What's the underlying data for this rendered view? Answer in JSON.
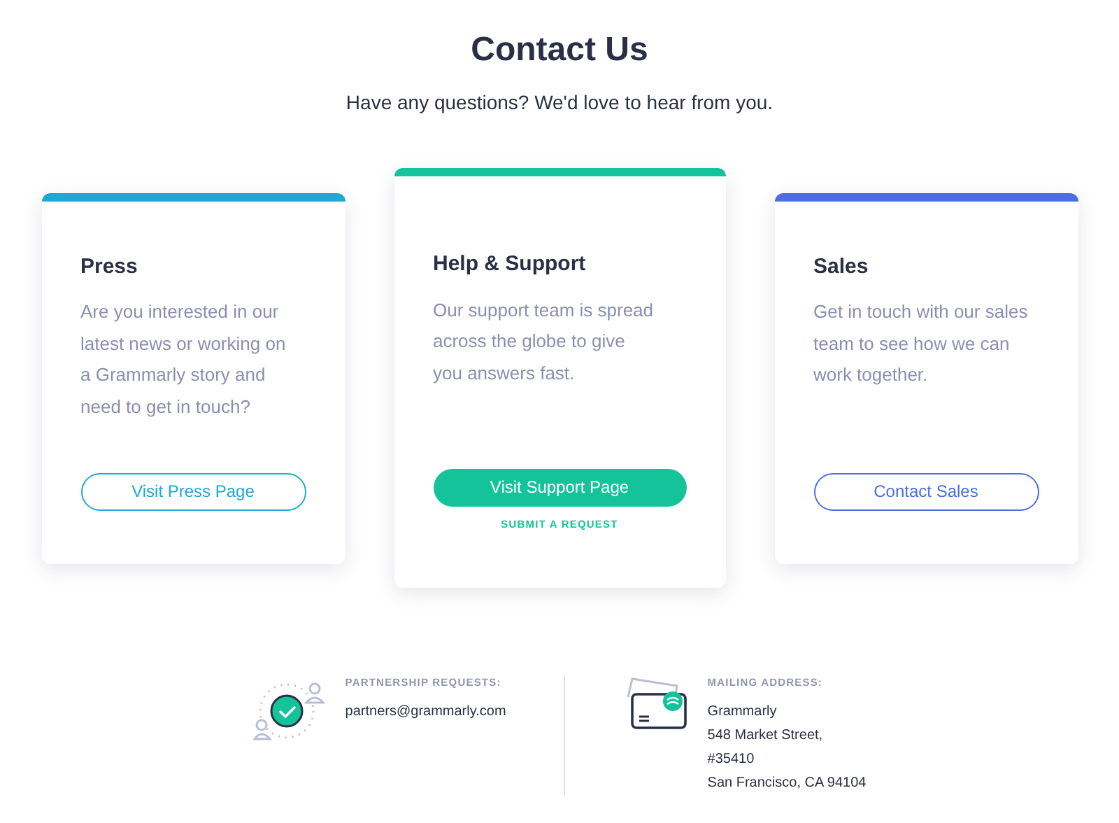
{
  "header": {
    "title": "Contact Us",
    "subtitle": "Have any questions? We'd love to hear from you."
  },
  "cards": [
    {
      "title": "Press",
      "description": "Are you interested in our latest news or working on a Grammarly story and need to get in touch?",
      "color": "#1fa8d2",
      "featured": false,
      "button": {
        "label": "Visit Press Page",
        "kind": "outline"
      }
    },
    {
      "title": "Help & Support",
      "description": "Our support team is spread across the globe to give you answers fast.",
      "color": "#15c39a",
      "featured": true,
      "button": {
        "label": "Visit Support Page",
        "kind": "filled"
      },
      "link": "SUBMIT A REQUEST"
    },
    {
      "title": "Sales",
      "description": "Get in touch with our sales team to see how we can work together.",
      "color": "#4a6ee0",
      "featured": false,
      "button": {
        "label": "Contact Sales",
        "kind": "outline"
      }
    }
  ],
  "footer": [
    {
      "kind": "partnership",
      "heading": "PARTNERSHIP REQUESTS:",
      "lines": [
        "partners@grammarly.com"
      ]
    },
    {
      "kind": "mail",
      "heading": "MAILING ADDRESS:",
      "lines": [
        "Grammarly",
        "548 Market Street,",
        "#35410",
        "San Francisco, CA 94104"
      ]
    }
  ]
}
